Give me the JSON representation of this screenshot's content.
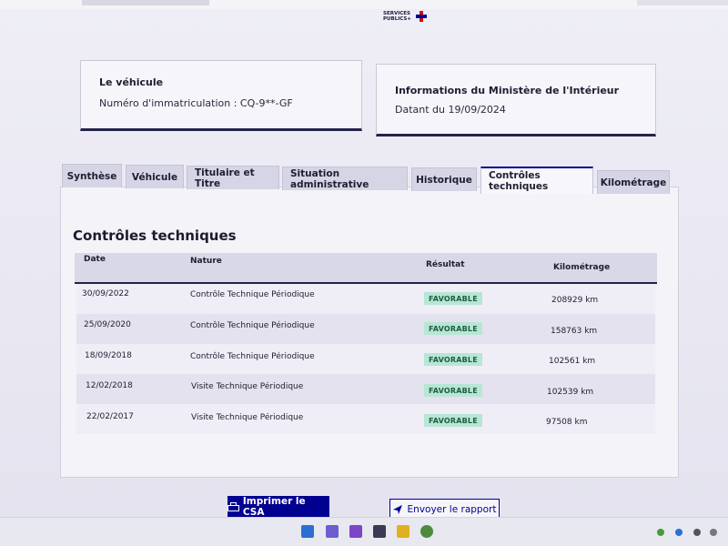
{
  "brand": {
    "logo_text": "SERVICES PUBLICS+"
  },
  "vehicle_card": {
    "title": "Le véhicule",
    "registration": "Numéro d'immatriculation : CQ-9**-GF"
  },
  "ministry_card": {
    "title": "Informations du Ministère de l'Intérieur",
    "date": "Datant du 19/09/2024"
  },
  "tabs": [
    {
      "label": "Synthèse",
      "active": false
    },
    {
      "label": "Véhicule",
      "active": false
    },
    {
      "label": "Titulaire et Titre",
      "active": false
    },
    {
      "label": "Situation administrative",
      "active": false
    },
    {
      "label": "Historique",
      "active": false
    },
    {
      "label": "Contrôles techniques",
      "active": true
    },
    {
      "label": "Kilométrage",
      "active": false
    }
  ],
  "section": {
    "title": "Contrôles techniques"
  },
  "table": {
    "headers": {
      "date": "Date",
      "nature": "Nature",
      "result": "Résultat",
      "mileage": "Kilométrage"
    },
    "rows": [
      {
        "date": "30/09/2022",
        "nature": "Contrôle Technique Périodique",
        "result": "FAVORABLE",
        "mileage": "208929 km"
      },
      {
        "date": "25/09/2020",
        "nature": "Contrôle Technique Périodique",
        "result": "FAVORABLE",
        "mileage": "158763 km"
      },
      {
        "date": "18/09/2018",
        "nature": "Contrôle Technique Périodique",
        "result": "FAVORABLE",
        "mileage": "102561 km"
      },
      {
        "date": "12/02/2018",
        "nature": "Visite Technique Périodique",
        "result": "FAVORABLE",
        "mileage": "102539 km"
      },
      {
        "date": "22/02/2017",
        "nature": "Visite Technique Périodique",
        "result": "FAVORABLE",
        "mileage": "97508 km"
      }
    ]
  },
  "actions": {
    "print_label": "Imprimer le CSA",
    "send_label": "Envoyer le rapport"
  },
  "colors": {
    "brand_blue": "#000091",
    "badge_bg": "#b8e6d3",
    "badge_text": "#1a5f46",
    "marianne_red": "#e1000f"
  },
  "taskbar": {
    "icons": [
      "windows-start-icon",
      "app-icon",
      "app-icon",
      "app-icon",
      "folder-icon",
      "browser-icon"
    ]
  }
}
